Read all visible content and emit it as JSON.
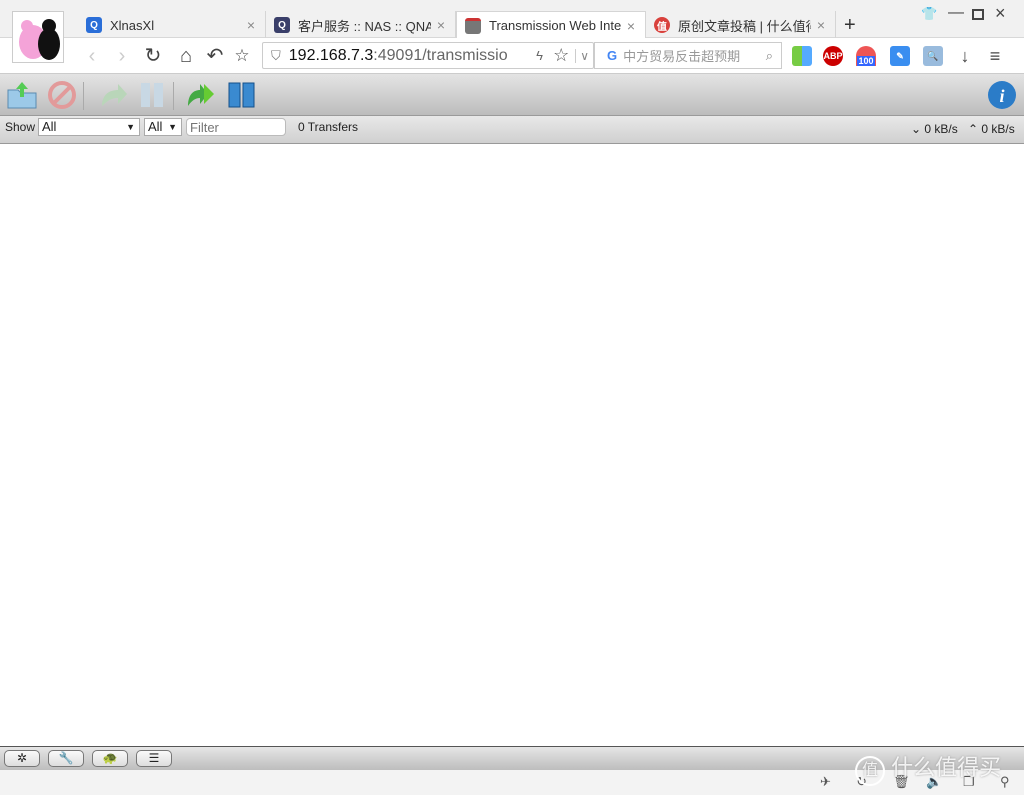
{
  "browser": {
    "tabs": [
      {
        "title": "XlnasXl",
        "icon": "qnap-icon",
        "color": "#2a6ed8"
      },
      {
        "title": "客户服务 :: NAS :: QNA",
        "icon": "qnap-icon",
        "color": "#3a3f6a"
      },
      {
        "title": "Transmission Web Inte",
        "icon": "transmission-icon",
        "color": "#884444",
        "active": true
      },
      {
        "title": "原创文章投稿 | 什么值得",
        "icon": "smzdm-icon",
        "color": "#d9413c"
      }
    ],
    "new_tab": "+",
    "url_host": "192.168.7.3",
    "url_rest": ":49091/transmissio",
    "search_placeholder": "中方贸易反击超预期",
    "ext_badge": "100",
    "ext_abp": "ABP"
  },
  "app": {
    "show_label": "Show",
    "filter_state": "All",
    "filter_tracker": "All",
    "filter_placeholder": "Filter",
    "transfers": "0 Transfers",
    "download_speed": "0 kB/s",
    "upload_speed": "0 kB/s"
  },
  "watermark": "什么值得买"
}
